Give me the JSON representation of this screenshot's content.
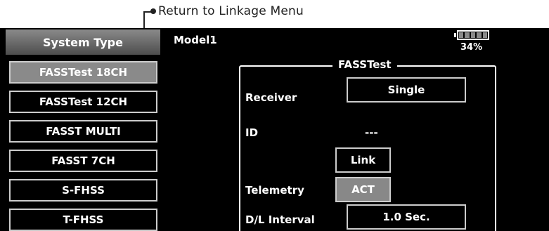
{
  "callout": {
    "text": "Return to Linkage Menu"
  },
  "header": {
    "tab_title": "System Type",
    "model_name": "Model1",
    "battery_percent_text": "34%",
    "battery_level": 0.34
  },
  "system_types": [
    {
      "label": "FASSTest 18CH",
      "active": true
    },
    {
      "label": "FASSTest 12CH",
      "active": false
    },
    {
      "label": "FASST MULTI",
      "active": false
    },
    {
      "label": "FASST 7CH",
      "active": false
    },
    {
      "label": "S-FHSS",
      "active": false
    },
    {
      "label": "T-FHSS",
      "active": false
    }
  ],
  "settings": {
    "group_title": "FASSTest",
    "receiver_label": "Receiver",
    "receiver_value": "Single",
    "id_label": "ID",
    "id_value": "---",
    "link_label": "Link",
    "telemetry_label": "Telemetry",
    "telemetry_value": "ACT",
    "dl_interval_label": "D/L Interval",
    "dl_interval_value": "1.0 Sec."
  },
  "colors": {
    "screen_bg": "#000000",
    "button_border": "#cccccc",
    "active_fill": "#8a8a8a"
  }
}
